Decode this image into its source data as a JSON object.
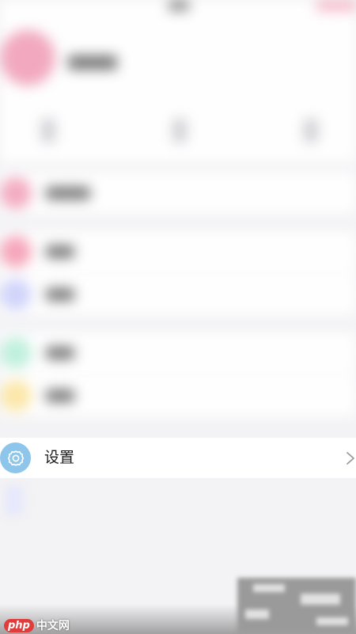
{
  "settings": {
    "label": "设置",
    "icon": "gear-icon",
    "icon_color": "#8ec5ea"
  },
  "watermark": {
    "logo": "php",
    "text": "中文网",
    "logo_color": "#e03c3c"
  },
  "theme": {
    "background": "#f3f3f5",
    "row_background": "#ffffff",
    "blurred_item_colors": [
      "#f4a9bf",
      "#f7a3b8",
      "#cfd3fb",
      "#bdf0dc",
      "#fde7a6"
    ]
  }
}
